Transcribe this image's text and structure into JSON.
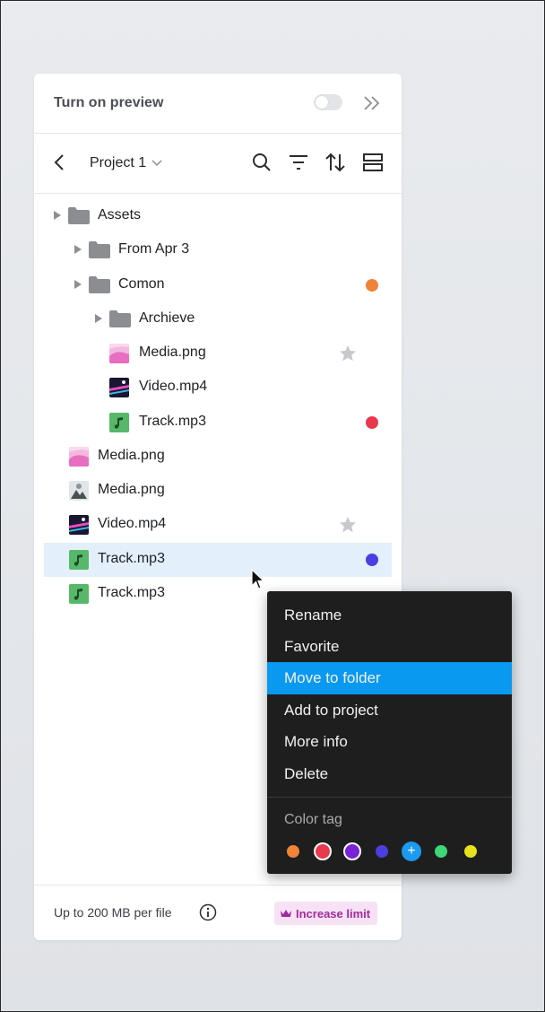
{
  "header": {
    "preview_label": "Turn on preview",
    "preview_on": false
  },
  "nav": {
    "project_label": "Project 1"
  },
  "tree": [
    {
      "name": "Assets",
      "kind": "folder",
      "depth": 0,
      "caret": true
    },
    {
      "name": "From Apr 3",
      "kind": "folder",
      "depth": 1,
      "caret": true
    },
    {
      "name": "Comon",
      "kind": "folder",
      "depth": 1,
      "caret": true,
      "tag": "#f0833a"
    },
    {
      "name": "Archieve",
      "kind": "folder",
      "depth": 2,
      "caret": true
    },
    {
      "name": "Media.png",
      "kind": "image-pink",
      "depth": 2,
      "star": true
    },
    {
      "name": "Video.mp4",
      "kind": "video",
      "depth": 2
    },
    {
      "name": "Track.mp3",
      "kind": "audio",
      "depth": 2,
      "tag": "#e8394f"
    },
    {
      "name": "Media.png",
      "kind": "image-pink",
      "depth": 0
    },
    {
      "name": "Media.png",
      "kind": "image-photo",
      "depth": 0
    },
    {
      "name": "Video.mp4",
      "kind": "video",
      "depth": 0,
      "star": true
    },
    {
      "name": "Track.mp3",
      "kind": "audio",
      "depth": 0,
      "tag": "#4b3fe0",
      "selected": true
    },
    {
      "name": "Track.mp3",
      "kind": "audio",
      "depth": 0
    }
  ],
  "footer": {
    "limit_text": "Up to 200 MB per file",
    "upgrade_label": "Increase limit"
  },
  "context_menu": {
    "items": [
      "Rename",
      "Favorite",
      "Move to folder",
      "Add to project",
      "More info",
      "Delete"
    ],
    "active_index": 2,
    "color_tag_label": "Color tag",
    "colors": [
      "#f0833a",
      "#e8394f",
      "#7a22d6",
      "#4b3fe0",
      "add",
      "#3fd67a",
      "#e6e21c"
    ],
    "selected_colors": [
      1,
      2
    ]
  },
  "colors": {
    "accent": "#0a99f0",
    "selection": "#e3f0fb",
    "upgrade_text": "#a12a9a"
  }
}
